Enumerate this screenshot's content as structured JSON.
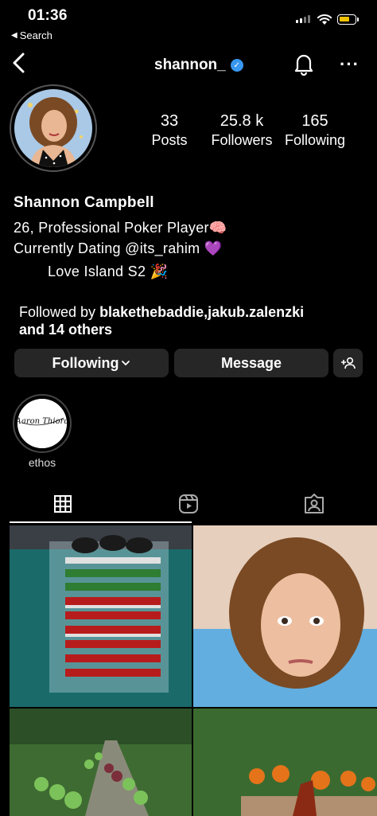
{
  "status_bar": {
    "time": "01:36",
    "back_app": "Search"
  },
  "header": {
    "username": "shannon_",
    "verified": true
  },
  "profile": {
    "stats": [
      {
        "value": "33",
        "label": "Posts"
      },
      {
        "value": "25.8 k",
        "label": "Followers"
      },
      {
        "value": "165",
        "label": "Following"
      }
    ],
    "name": "Shannon Campbell",
    "bio_lines": [
      "26, Professional Poker Player🧠",
      "Currently Dating @its_rahim 💜",
      "Love Island S2 🎉"
    ],
    "followed_by_prefix": "Followed by ",
    "followed_by_names": "blakethebaddie,jakub.zalenzki",
    "followed_by_suffix": "and 14 others"
  },
  "actions": {
    "following": "Following",
    "message": "Message"
  },
  "highlights": [
    {
      "label": "ethos",
      "cover_text": "Aaron Thiora"
    }
  ],
  "tabs": [
    "grid-icon",
    "reels-icon",
    "tagged-icon"
  ],
  "colors": {
    "verified": "#3897f0",
    "button_bg": "#262626",
    "battery": "#f5c400",
    "background": "#000000"
  }
}
